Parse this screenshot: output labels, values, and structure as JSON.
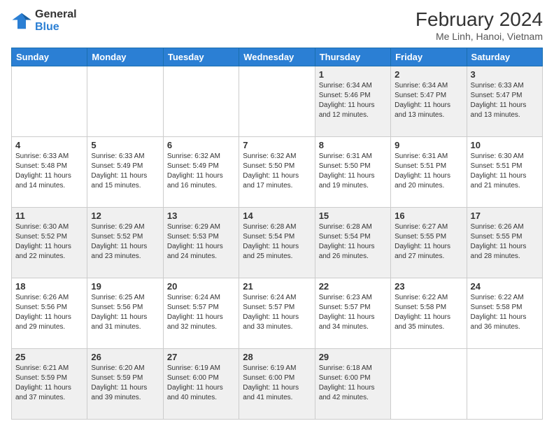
{
  "logo": {
    "line1": "General",
    "line2": "Blue"
  },
  "title": "February 2024",
  "location": "Me Linh, Hanoi, Vietnam",
  "weekdays": [
    "Sunday",
    "Monday",
    "Tuesday",
    "Wednesday",
    "Thursday",
    "Friday",
    "Saturday"
  ],
  "weeks": [
    [
      {
        "day": "",
        "sunrise": "",
        "sunset": "",
        "daylight": ""
      },
      {
        "day": "",
        "sunrise": "",
        "sunset": "",
        "daylight": ""
      },
      {
        "day": "",
        "sunrise": "",
        "sunset": "",
        "daylight": ""
      },
      {
        "day": "",
        "sunrise": "",
        "sunset": "",
        "daylight": ""
      },
      {
        "day": "1",
        "sunrise": "Sunrise: 6:34 AM",
        "sunset": "Sunset: 5:46 PM",
        "daylight": "Daylight: 11 hours and 12 minutes."
      },
      {
        "day": "2",
        "sunrise": "Sunrise: 6:34 AM",
        "sunset": "Sunset: 5:47 PM",
        "daylight": "Daylight: 11 hours and 13 minutes."
      },
      {
        "day": "3",
        "sunrise": "Sunrise: 6:33 AM",
        "sunset": "Sunset: 5:47 PM",
        "daylight": "Daylight: 11 hours and 13 minutes."
      }
    ],
    [
      {
        "day": "4",
        "sunrise": "Sunrise: 6:33 AM",
        "sunset": "Sunset: 5:48 PM",
        "daylight": "Daylight: 11 hours and 14 minutes."
      },
      {
        "day": "5",
        "sunrise": "Sunrise: 6:33 AM",
        "sunset": "Sunset: 5:49 PM",
        "daylight": "Daylight: 11 hours and 15 minutes."
      },
      {
        "day": "6",
        "sunrise": "Sunrise: 6:32 AM",
        "sunset": "Sunset: 5:49 PM",
        "daylight": "Daylight: 11 hours and 16 minutes."
      },
      {
        "day": "7",
        "sunrise": "Sunrise: 6:32 AM",
        "sunset": "Sunset: 5:50 PM",
        "daylight": "Daylight: 11 hours and 17 minutes."
      },
      {
        "day": "8",
        "sunrise": "Sunrise: 6:31 AM",
        "sunset": "Sunset: 5:50 PM",
        "daylight": "Daylight: 11 hours and 19 minutes."
      },
      {
        "day": "9",
        "sunrise": "Sunrise: 6:31 AM",
        "sunset": "Sunset: 5:51 PM",
        "daylight": "Daylight: 11 hours and 20 minutes."
      },
      {
        "day": "10",
        "sunrise": "Sunrise: 6:30 AM",
        "sunset": "Sunset: 5:51 PM",
        "daylight": "Daylight: 11 hours and 21 minutes."
      }
    ],
    [
      {
        "day": "11",
        "sunrise": "Sunrise: 6:30 AM",
        "sunset": "Sunset: 5:52 PM",
        "daylight": "Daylight: 11 hours and 22 minutes."
      },
      {
        "day": "12",
        "sunrise": "Sunrise: 6:29 AM",
        "sunset": "Sunset: 5:52 PM",
        "daylight": "Daylight: 11 hours and 23 minutes."
      },
      {
        "day": "13",
        "sunrise": "Sunrise: 6:29 AM",
        "sunset": "Sunset: 5:53 PM",
        "daylight": "Daylight: 11 hours and 24 minutes."
      },
      {
        "day": "14",
        "sunrise": "Sunrise: 6:28 AM",
        "sunset": "Sunset: 5:54 PM",
        "daylight": "Daylight: 11 hours and 25 minutes."
      },
      {
        "day": "15",
        "sunrise": "Sunrise: 6:28 AM",
        "sunset": "Sunset: 5:54 PM",
        "daylight": "Daylight: 11 hours and 26 minutes."
      },
      {
        "day": "16",
        "sunrise": "Sunrise: 6:27 AM",
        "sunset": "Sunset: 5:55 PM",
        "daylight": "Daylight: 11 hours and 27 minutes."
      },
      {
        "day": "17",
        "sunrise": "Sunrise: 6:26 AM",
        "sunset": "Sunset: 5:55 PM",
        "daylight": "Daylight: 11 hours and 28 minutes."
      }
    ],
    [
      {
        "day": "18",
        "sunrise": "Sunrise: 6:26 AM",
        "sunset": "Sunset: 5:56 PM",
        "daylight": "Daylight: 11 hours and 29 minutes."
      },
      {
        "day": "19",
        "sunrise": "Sunrise: 6:25 AM",
        "sunset": "Sunset: 5:56 PM",
        "daylight": "Daylight: 11 hours and 31 minutes."
      },
      {
        "day": "20",
        "sunrise": "Sunrise: 6:24 AM",
        "sunset": "Sunset: 5:57 PM",
        "daylight": "Daylight: 11 hours and 32 minutes."
      },
      {
        "day": "21",
        "sunrise": "Sunrise: 6:24 AM",
        "sunset": "Sunset: 5:57 PM",
        "daylight": "Daylight: 11 hours and 33 minutes."
      },
      {
        "day": "22",
        "sunrise": "Sunrise: 6:23 AM",
        "sunset": "Sunset: 5:57 PM",
        "daylight": "Daylight: 11 hours and 34 minutes."
      },
      {
        "day": "23",
        "sunrise": "Sunrise: 6:22 AM",
        "sunset": "Sunset: 5:58 PM",
        "daylight": "Daylight: 11 hours and 35 minutes."
      },
      {
        "day": "24",
        "sunrise": "Sunrise: 6:22 AM",
        "sunset": "Sunset: 5:58 PM",
        "daylight": "Daylight: 11 hours and 36 minutes."
      }
    ],
    [
      {
        "day": "25",
        "sunrise": "Sunrise: 6:21 AM",
        "sunset": "Sunset: 5:59 PM",
        "daylight": "Daylight: 11 hours and 37 minutes."
      },
      {
        "day": "26",
        "sunrise": "Sunrise: 6:20 AM",
        "sunset": "Sunset: 5:59 PM",
        "daylight": "Daylight: 11 hours and 39 minutes."
      },
      {
        "day": "27",
        "sunrise": "Sunrise: 6:19 AM",
        "sunset": "Sunset: 6:00 PM",
        "daylight": "Daylight: 11 hours and 40 minutes."
      },
      {
        "day": "28",
        "sunrise": "Sunrise: 6:19 AM",
        "sunset": "Sunset: 6:00 PM",
        "daylight": "Daylight: 11 hours and 41 minutes."
      },
      {
        "day": "29",
        "sunrise": "Sunrise: 6:18 AM",
        "sunset": "Sunset: 6:00 PM",
        "daylight": "Daylight: 11 hours and 42 minutes."
      },
      {
        "day": "",
        "sunrise": "",
        "sunset": "",
        "daylight": ""
      },
      {
        "day": "",
        "sunrise": "",
        "sunset": "",
        "daylight": ""
      }
    ]
  ]
}
